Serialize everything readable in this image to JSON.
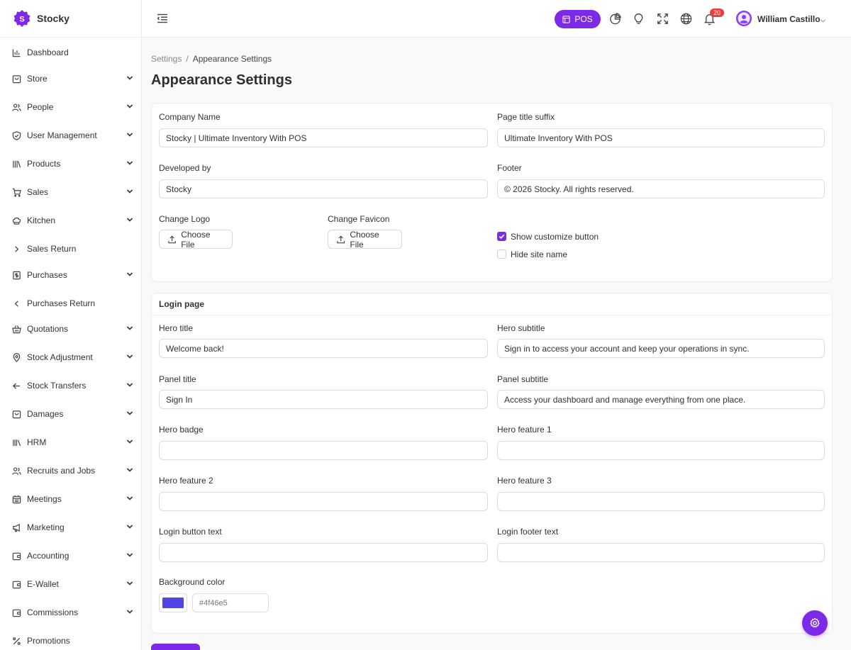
{
  "brand": {
    "name": "Stocky",
    "logo_letter": "S",
    "accent": "#7c2ae8"
  },
  "sidebar": {
    "items": [
      {
        "label": "Dashboard",
        "icon": "bar-chart-icon",
        "chevron": "none"
      },
      {
        "label": "Store",
        "icon": "store-icon",
        "chevron": "down"
      },
      {
        "label": "People",
        "icon": "people-icon",
        "chevron": "down"
      },
      {
        "label": "User Management",
        "icon": "shield-icon",
        "chevron": "down"
      },
      {
        "label": "Products",
        "icon": "products-icon",
        "chevron": "down"
      },
      {
        "label": "Sales",
        "icon": "cart-icon",
        "chevron": "down"
      },
      {
        "label": "Kitchen",
        "icon": "chef-hat-icon",
        "chevron": "down"
      },
      {
        "label": "Sales Return",
        "icon": "chevron-right-icon",
        "chevron": "none"
      },
      {
        "label": "Purchases",
        "icon": "receipt-icon",
        "chevron": "down"
      },
      {
        "label": "Purchases Return",
        "icon": "chevron-left-icon",
        "chevron": "none"
      },
      {
        "label": "Quotations",
        "icon": "basket-icon",
        "chevron": "down"
      },
      {
        "label": "Stock Adjustment",
        "icon": "location-pin-icon",
        "chevron": "down"
      },
      {
        "label": "Stock Transfers",
        "icon": "arrow-left-icon",
        "chevron": "down"
      },
      {
        "label": "Damages",
        "icon": "bag-icon",
        "chevron": "down"
      },
      {
        "label": "HRM",
        "icon": "library-icon",
        "chevron": "down"
      },
      {
        "label": "Recruits and Jobs",
        "icon": "people-icon",
        "chevron": "down"
      },
      {
        "label": "Meetings",
        "icon": "calendar-icon",
        "chevron": "down"
      },
      {
        "label": "Marketing",
        "icon": "megaphone-icon",
        "chevron": "down"
      },
      {
        "label": "Accounting",
        "icon": "wallet-icon",
        "chevron": "down"
      },
      {
        "label": "E-Wallet",
        "icon": "wallet-icon",
        "chevron": "down"
      },
      {
        "label": "Commissions",
        "icon": "wallet-icon",
        "chevron": "down"
      },
      {
        "label": "Promotions",
        "icon": "percent-icon",
        "chevron": "none"
      }
    ]
  },
  "header": {
    "pos_label": "POS",
    "notification_count": "20",
    "user_name": "William Castillo",
    "icons": [
      "pie-chart-icon",
      "lightbulb-icon",
      "fullscreen-icon",
      "globe-icon",
      "bell-icon"
    ]
  },
  "breadcrumb": {
    "parent": "Settings",
    "separator": "/",
    "current": "Appearance Settings"
  },
  "page_title": "Appearance Settings",
  "general": {
    "company_name_label": "Company Name",
    "company_name_value": "Stocky | Ultimate Inventory With POS",
    "title_suffix_label": "Page title suffix",
    "title_suffix_value": "Ultimate Inventory With POS",
    "developed_by_label": "Developed by",
    "developed_by_value": "Stocky",
    "footer_label": "Footer",
    "footer_value": "© 2026 Stocky. All rights reserved.",
    "change_logo_label": "Change Logo",
    "change_favicon_label": "Change Favicon",
    "choose_file_label": "Choose File",
    "show_customize_label": "Show customize button",
    "show_customize_checked": true,
    "hide_site_name_label": "Hide site name",
    "hide_site_name_checked": false
  },
  "login": {
    "section_title": "Login page",
    "hero_title_label": "Hero title",
    "hero_title_value": "Welcome back!",
    "hero_subtitle_label": "Hero subtitle",
    "hero_subtitle_value": "Sign in to access your account and keep your operations in sync.",
    "panel_title_label": "Panel title",
    "panel_title_value": "Sign In",
    "panel_subtitle_label": "Panel subtitle",
    "panel_subtitle_value": "Access your dashboard and manage everything from one place.",
    "hero_badge_label": "Hero badge",
    "hero_badge_value": "",
    "hero_feature1_label": "Hero feature 1",
    "hero_feature1_value": "",
    "hero_feature2_label": "Hero feature 2",
    "hero_feature2_value": "",
    "hero_feature3_label": "Hero feature 3",
    "hero_feature3_value": "",
    "login_button_text_label": "Login button text",
    "login_button_text_value": "",
    "login_footer_text_label": "Login footer text",
    "login_footer_text_value": "",
    "background_color_label": "Background color",
    "background_color_value": "#4f46e5",
    "background_color_placeholder": "#4f46e5"
  }
}
